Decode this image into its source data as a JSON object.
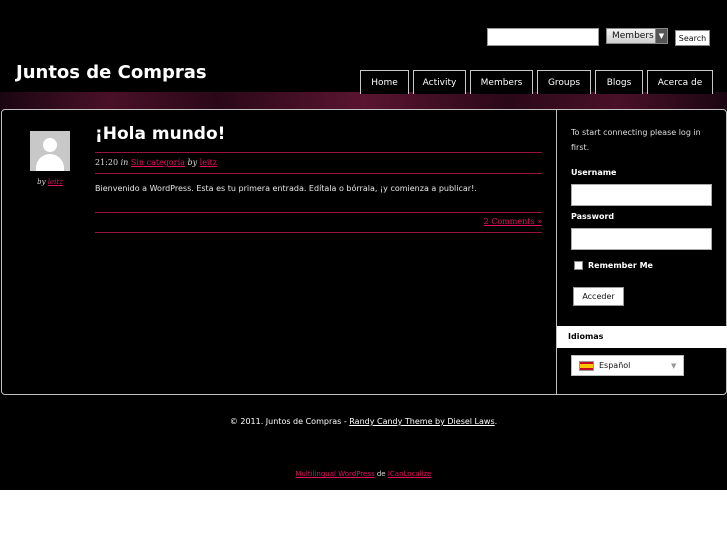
{
  "header": {
    "site_title": "Juntos de Compras",
    "search": {
      "input_value": "",
      "select_value": "Members",
      "button_label": "Search"
    },
    "nav": [
      {
        "label": "Home"
      },
      {
        "label": "Activity"
      },
      {
        "label": "Members"
      },
      {
        "label": "Groups"
      },
      {
        "label": "Blogs"
      },
      {
        "label": "Acerca de"
      }
    ]
  },
  "post": {
    "author_prefix": "by",
    "author": "leitz",
    "title": "¡Hola mundo!",
    "time": "21:20",
    "in_word": "in",
    "category": "Sin categoría",
    "by_word": "by",
    "body": "Bienvenido a WordPress. Esta es tu primera entrada. Edítala o bórrala, ¡y comienza a publicar!.",
    "comments_link": "2 Comments »"
  },
  "sidebar": {
    "login_intro": "To start connecting please log in first.",
    "username_label": "Username",
    "password_label": "Password",
    "remember_label": "Remember Me",
    "login_button": "Acceder",
    "idiomas_title": "Idiomas",
    "language_selected": "Español"
  },
  "footer": {
    "copyright": "© 2011. Juntos de Compras - ",
    "theme_link": "Randy Candy Theme by Diesel Laws",
    "period": ".",
    "ml_link1": "Multilingual WordPress",
    "ml_word": " de ",
    "ml_link2": "ICanLocalize"
  },
  "colors": {
    "accent": "#e0115f",
    "background": "#000000"
  }
}
